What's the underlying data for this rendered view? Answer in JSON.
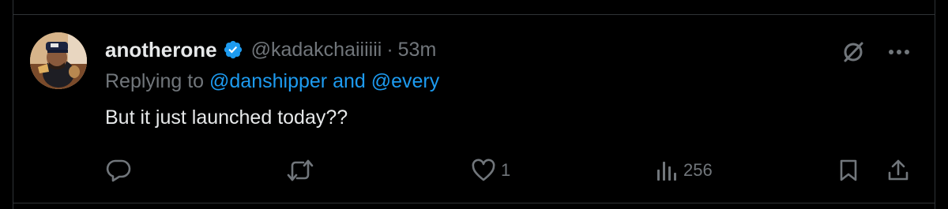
{
  "tweet": {
    "display_name": "anotherone",
    "handle": "@kadakchaiiiiii",
    "separator": "·",
    "time_ago": "53m",
    "replying_prefix": "Replying to",
    "replying_user_1": "@danshipper",
    "replying_and": "and",
    "replying_user_2": "@every",
    "text": "But it just launched today??"
  },
  "actions": {
    "reply_count": "",
    "retweet_count": "",
    "like_count": "1",
    "views_count": "256"
  },
  "colors": {
    "background": "#000000",
    "primary_text": "#e7e9ea",
    "secondary_text": "#71767b",
    "link": "#1d9bf0",
    "verified": "#1d9bf0",
    "divider": "#2f3336"
  },
  "icons": {
    "avatar": "avatar-photo",
    "verified": "verified-badge-icon",
    "grok": "grok-icon",
    "more": "more-icon",
    "reply": "reply-icon",
    "retweet": "retweet-icon",
    "like": "heart-icon",
    "views": "views-icon",
    "bookmark": "bookmark-icon",
    "share": "share-icon"
  }
}
